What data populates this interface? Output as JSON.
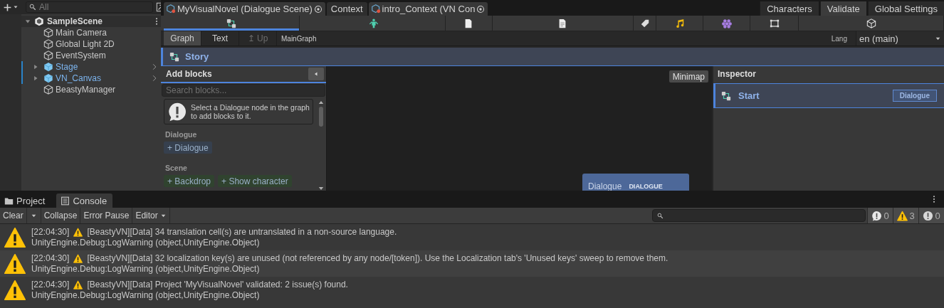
{
  "hierarchy": {
    "search": {
      "placeholder": "All"
    },
    "scene": {
      "name": "SampleScene",
      "expanded": true,
      "children": [
        {
          "name": "Main Camera",
          "kind": "object"
        },
        {
          "name": "Global Light 2D",
          "kind": "object"
        },
        {
          "name": "EventSystem",
          "kind": "object"
        },
        {
          "name": "Stage",
          "kind": "prefab",
          "expanded": false
        },
        {
          "name": "VN_Canvas",
          "kind": "prefab",
          "expanded": false
        },
        {
          "name": "BeastyManager",
          "kind": "object"
        }
      ]
    }
  },
  "editor": {
    "doc_tabs": [
      {
        "label": "MyVisualNovel (Dialogue Scene)",
        "kind": "asset"
      },
      {
        "label": "Context",
        "kind": "plain"
      },
      {
        "label": "intro_Context (VN Con",
        "kind": "asset"
      }
    ],
    "right_tabs": [
      {
        "label": "Characters",
        "selected": false
      },
      {
        "label": "Validate",
        "selected": true
      },
      {
        "label": "Global Settings",
        "selected": false
      }
    ],
    "toolbar": [
      {
        "kind": "graph",
        "selected": true
      },
      {
        "kind": "figure",
        "selected": false
      },
      {
        "kind": "page",
        "selected": false
      },
      {
        "kind": "page-lines",
        "selected": false
      },
      {
        "kind": "tag",
        "selected": false
      },
      {
        "kind": "music",
        "selected": false
      },
      {
        "kind": "hexagons",
        "selected": false
      },
      {
        "kind": "frame",
        "selected": false
      },
      {
        "kind": "cube",
        "selected": false
      }
    ],
    "view_tabs": [
      {
        "label": "Graph",
        "selected": true
      },
      {
        "label": "Text",
        "selected": false
      }
    ],
    "up_button": {
      "label": "↥ Up",
      "disabled": true
    },
    "graph_path": "MainGraph",
    "lang": {
      "label": "Lang",
      "value": "en (main)"
    },
    "breadcrumb": "Story",
    "add_blocks": {
      "title": "Add blocks",
      "search": {
        "placeholder": "Search blocks..."
      },
      "hint": "Select a Dialogue node in the graph to add blocks to it.",
      "sections": [
        {
          "title": "Dialogue",
          "blocks": [
            {
              "label": "+ Dialogue",
              "color": "#36404e"
            }
          ]
        },
        {
          "title": "Scene",
          "blocks": [
            {
              "label": "+ Backdrop",
              "color": "#30432f"
            },
            {
              "label": "+ Show character",
              "color": "#30432f"
            }
          ]
        }
      ]
    },
    "canvas": {
      "minimap": "Minimap",
      "node": {
        "title": "Dialogue",
        "type": "DIALOGUE"
      }
    },
    "inspector": {
      "title": "Inspector",
      "item": {
        "name": "Start",
        "badge": "Dialogue"
      }
    }
  },
  "console": {
    "tabs": [
      {
        "label": "Project",
        "kind": "folder",
        "selected": false
      },
      {
        "label": "Console",
        "kind": "console",
        "selected": true
      }
    ],
    "toolbar": [
      {
        "label": "Clear",
        "kind": "button"
      },
      {
        "kind": "dropdown-arrow"
      },
      {
        "label": "Collapse",
        "kind": "button"
      },
      {
        "label": "Error Pause",
        "kind": "button"
      },
      {
        "label": "Editor",
        "kind": "dropdown"
      }
    ],
    "counts": [
      {
        "kind": "info",
        "count": "0"
      },
      {
        "kind": "warning",
        "count": "3"
      },
      {
        "kind": "error",
        "count": "0"
      }
    ],
    "logs": [
      {
        "kind": "warning",
        "time": "[22:04:30]",
        "message": "[BeastyVN][Data] 34 translation cell(s) are untranslated in a non-source language.",
        "trace": "UnityEngine.Debug:LogWarning (object,UnityEngine.Object)"
      },
      {
        "kind": "warning",
        "time": "[22:04:30]",
        "message": "[BeastyVN][Data] 32 localization key(s) are unused (not referenced by any node/[token]). Use the Localization tab's 'Unused keys' sweep to remove them.",
        "trace": "UnityEngine.Debug:LogWarning (object,UnityEngine.Object)"
      },
      {
        "kind": "warning",
        "time": "[22:04:30]",
        "message": "[BeastyVN][Data] Project 'MyVisualNovel' validated: 2 issue(s) found.",
        "trace": "UnityEngine.Debug:LogWarning (object,UnityEngine.Object)"
      }
    ]
  }
}
